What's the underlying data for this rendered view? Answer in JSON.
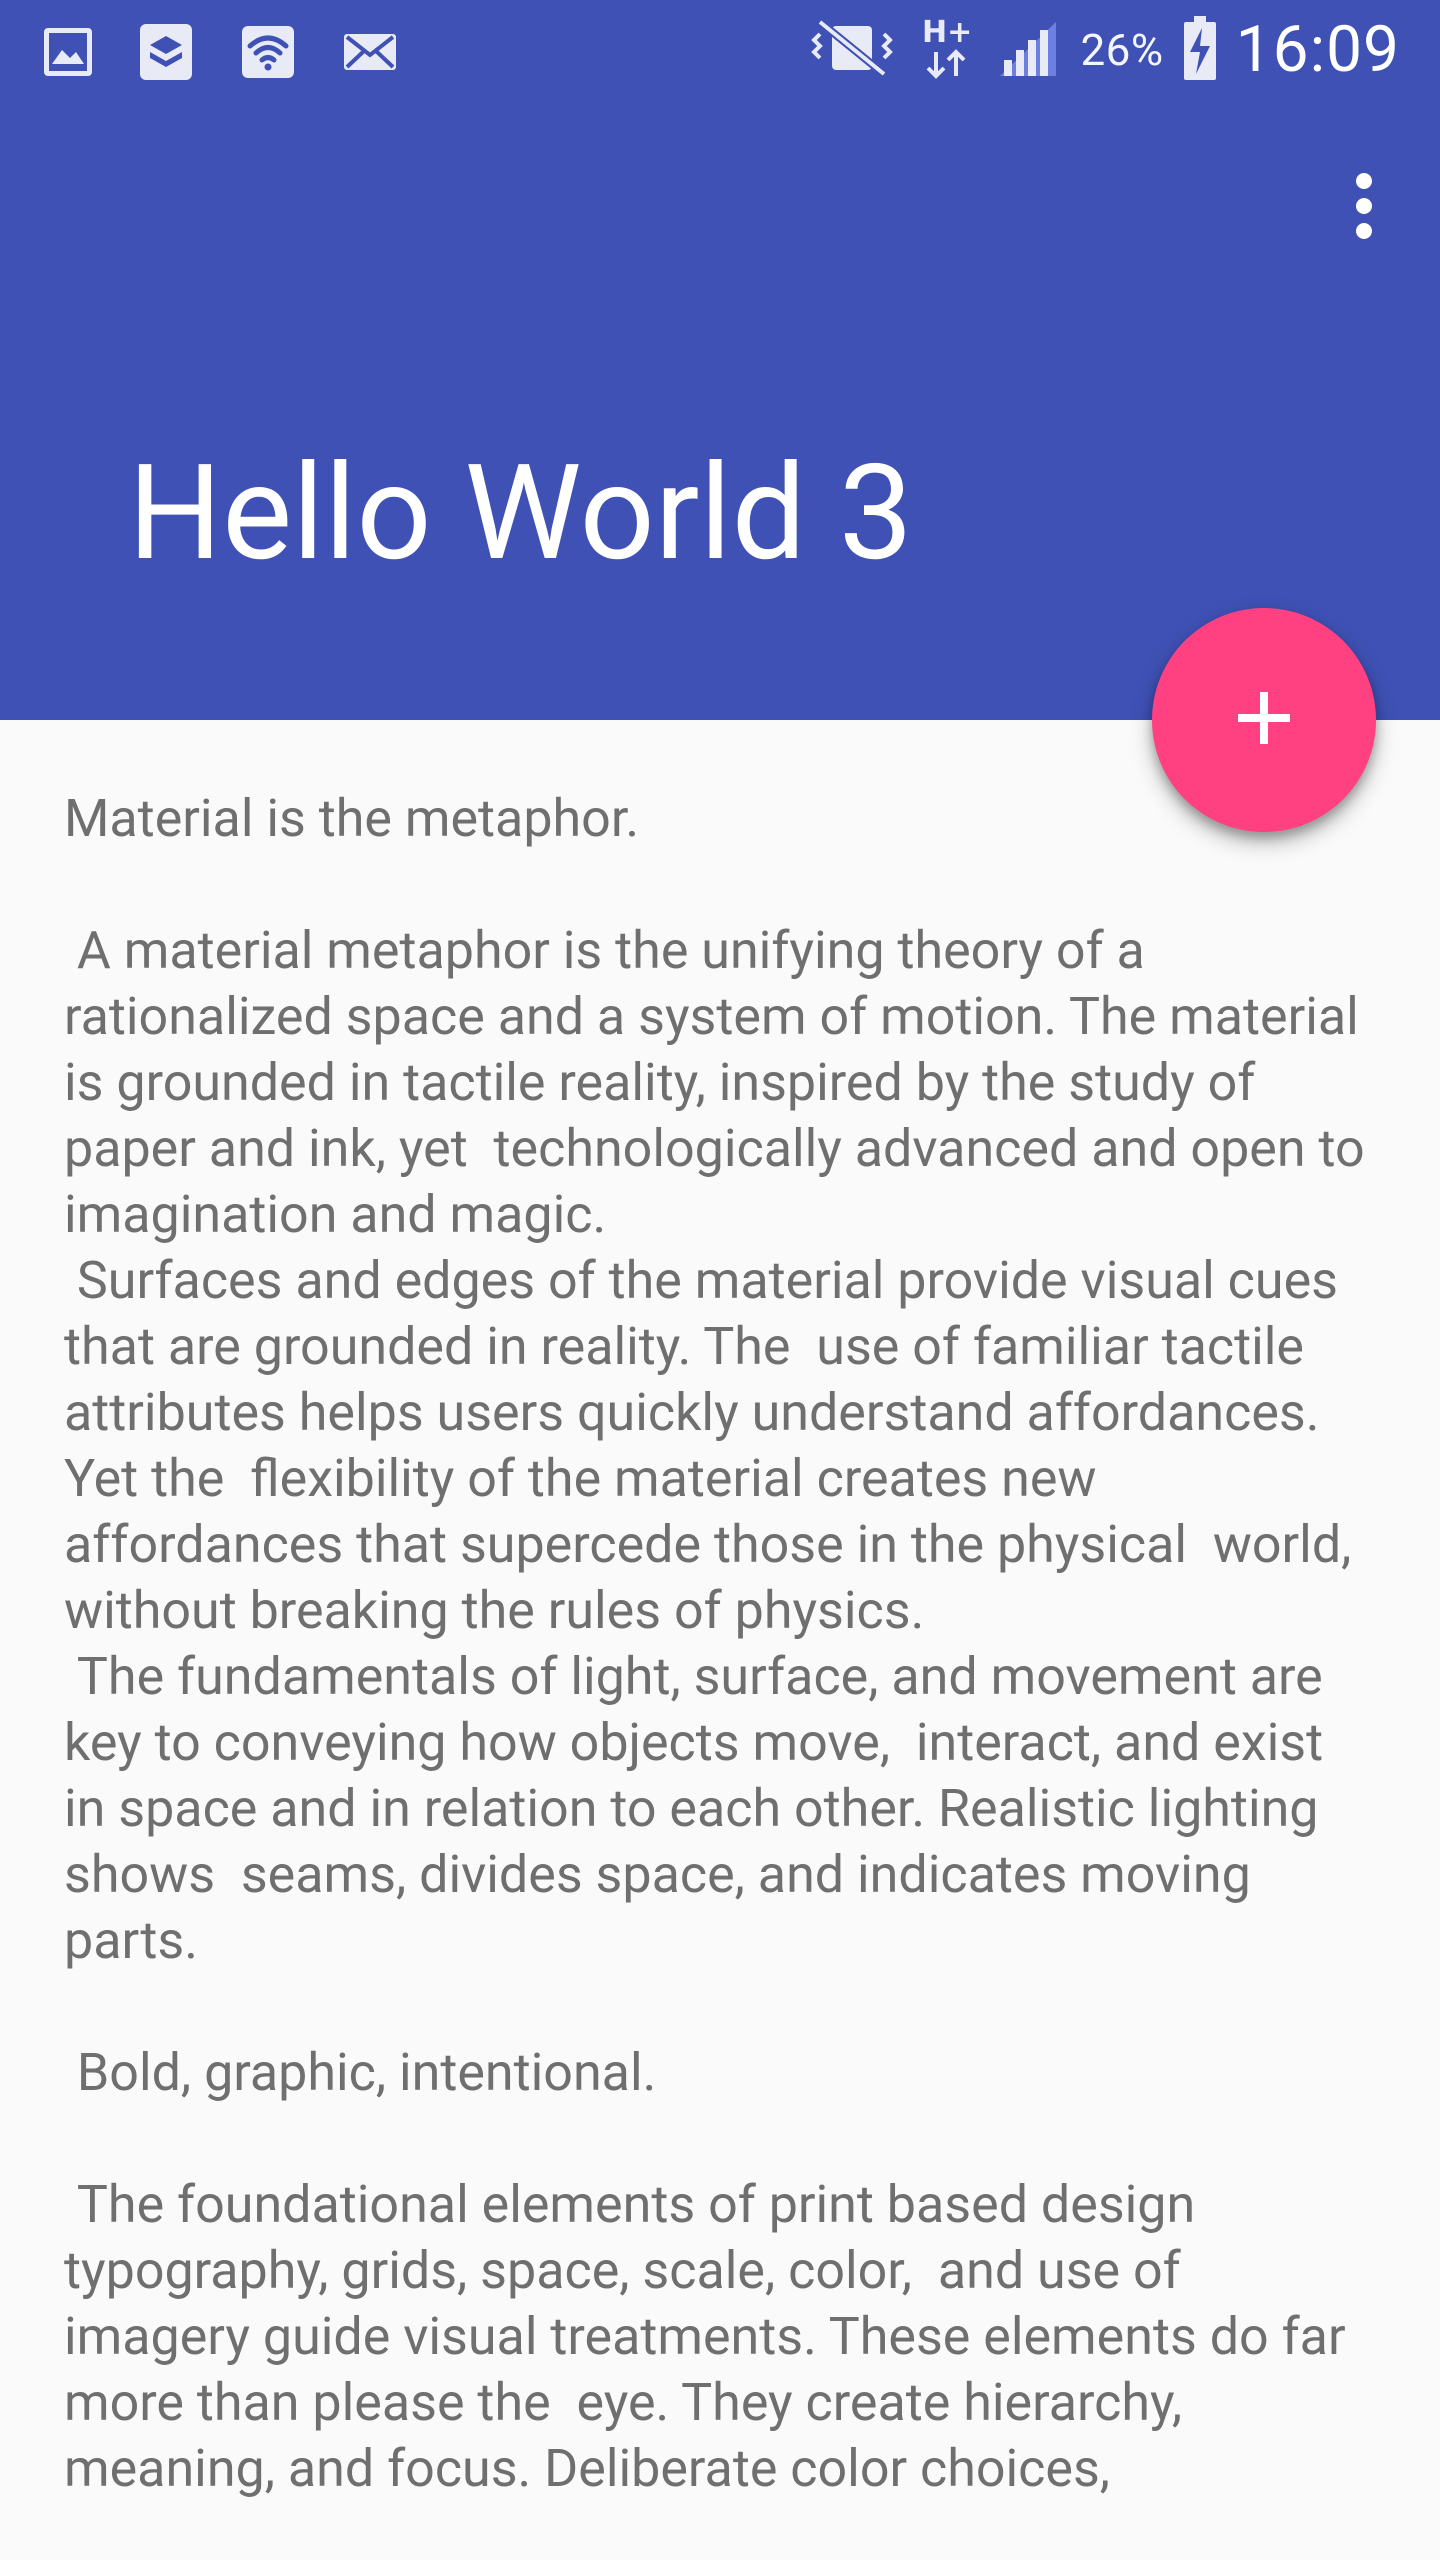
{
  "status_bar": {
    "battery_percent": "26%",
    "time": "16:09",
    "icons_left": [
      "gallery-icon",
      "layers-icon",
      "wifi-icon",
      "mail-icon"
    ],
    "icons_right": [
      "vibrate-icon",
      "network-h-plus-icon",
      "signal-icon",
      "battery-charging-icon"
    ]
  },
  "app_bar": {
    "title": "Hello World 3",
    "menu_icon": "more-vert-icon",
    "color": "#3F51B5"
  },
  "fab": {
    "icon": "plus-icon",
    "color": "#FF4081"
  },
  "content": {
    "paragraphs": [
      "Material is the metaphor.",
      " A material metaphor is the unifying theory of a rationalized space and a system of motion. The material is grounded in tactile reality, inspired by the study of paper and ink, yet  technologically advanced and open to imagination and magic.\n Surfaces and edges of the material provide visual cues that are grounded in reality. The  use of familiar tactile attributes helps users quickly understand affordances. Yet the  flexibility of the material creates new affordances that supercede those in the physical  world, without breaking the rules of physics.\n The fundamentals of light, surface, and movement are key to conveying how objects move,  interact, and exist in space and in relation to each other. Realistic lighting shows  seams, divides space, and indicates moving parts.",
      " Bold, graphic, intentional.",
      " The foundational elements of print based design typography, grids, space, scale, color,  and use of imagery guide visual treatments. These elements do far more than please the  eye. They create hierarchy, meaning, and focus. Deliberate color choices,"
    ]
  }
}
